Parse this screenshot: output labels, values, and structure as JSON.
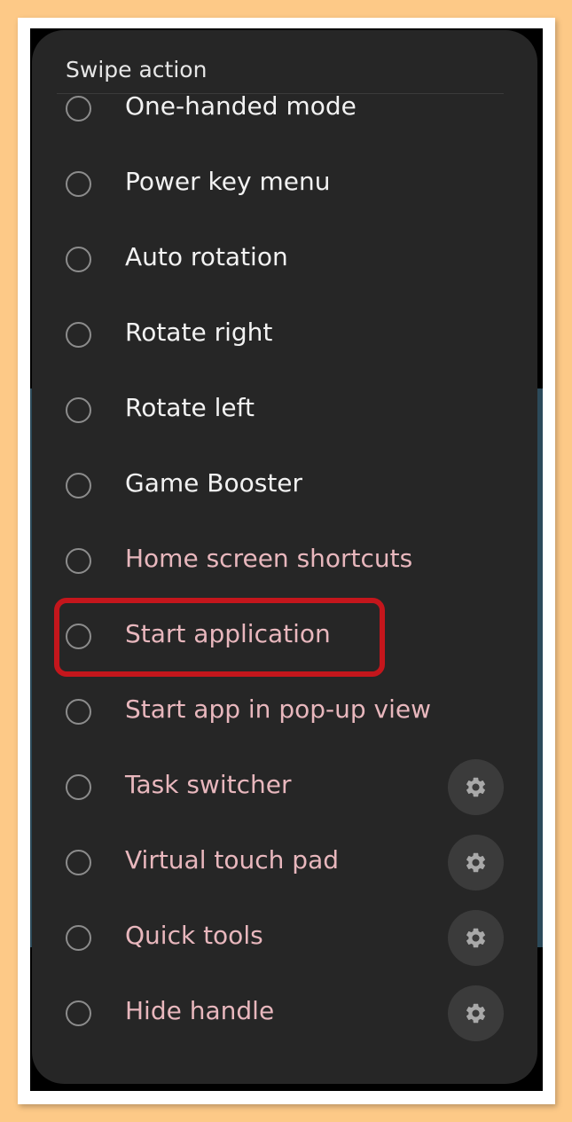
{
  "dialog": {
    "title": "Swipe action",
    "options": [
      {
        "label": "One-handed mode",
        "enabled": true,
        "has_settings": false
      },
      {
        "label": "Power key menu",
        "enabled": true,
        "has_settings": false
      },
      {
        "label": "Auto rotation",
        "enabled": true,
        "has_settings": false
      },
      {
        "label": "Rotate right",
        "enabled": true,
        "has_settings": false
      },
      {
        "label": "Rotate left",
        "enabled": true,
        "has_settings": false
      },
      {
        "label": "Game Booster",
        "enabled": true,
        "has_settings": false
      },
      {
        "label": "Home screen shortcuts",
        "enabled": false,
        "has_settings": false
      },
      {
        "label": "Start application",
        "enabled": false,
        "has_settings": false,
        "highlighted": true
      },
      {
        "label": "Start app in pop-up view",
        "enabled": false,
        "has_settings": false
      },
      {
        "label": "Task switcher",
        "enabled": false,
        "has_settings": true
      },
      {
        "label": "Virtual touch pad",
        "enabled": false,
        "has_settings": true
      },
      {
        "label": "Quick tools",
        "enabled": false,
        "has_settings": true
      },
      {
        "label": "Hide handle",
        "enabled": false,
        "has_settings": true
      }
    ]
  },
  "colors": {
    "background": "#fdc987",
    "dialog": "#262626",
    "text_enabled": "#f2f2f2",
    "text_dim": "#e8b7bd",
    "highlight_border": "#c4161c",
    "edge_panel": "#2c4a5a"
  },
  "icons": {
    "radio": "radio-unchecked-icon",
    "settings": "gear-icon"
  }
}
